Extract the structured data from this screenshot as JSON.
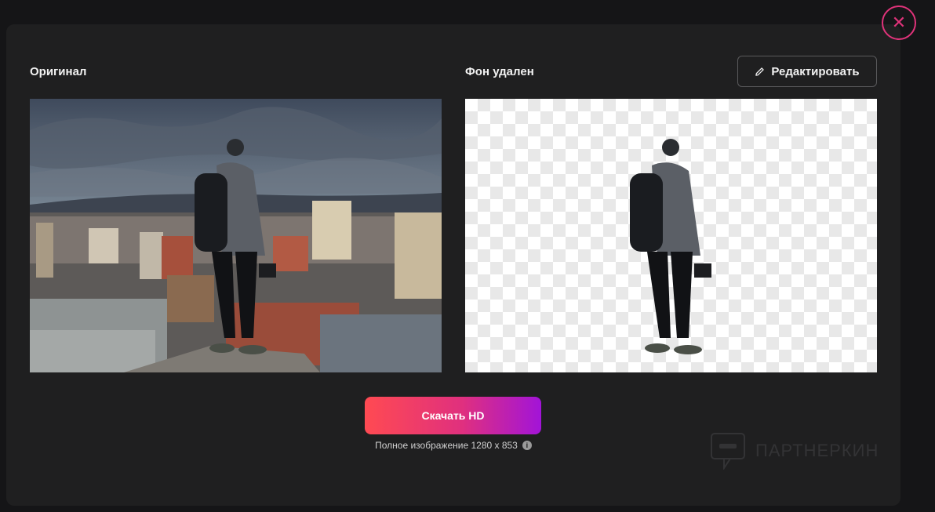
{
  "close": {
    "icon": "close-icon",
    "glyph": "✕"
  },
  "original": {
    "label": "Оригинал"
  },
  "removed": {
    "label": "Фон удален"
  },
  "edit": {
    "label": "Редактировать",
    "icon": "pencil-icon"
  },
  "download": {
    "label": "Скачать HD"
  },
  "full_image": {
    "text": "Полное изображение 1280 x 853",
    "info_glyph": "i"
  },
  "watermark": {
    "text": "ПАРТНЕРКИН"
  },
  "colors": {
    "accent": "#e0337a",
    "gradient_start": "#ff4a52",
    "gradient_end": "#a214d8"
  }
}
